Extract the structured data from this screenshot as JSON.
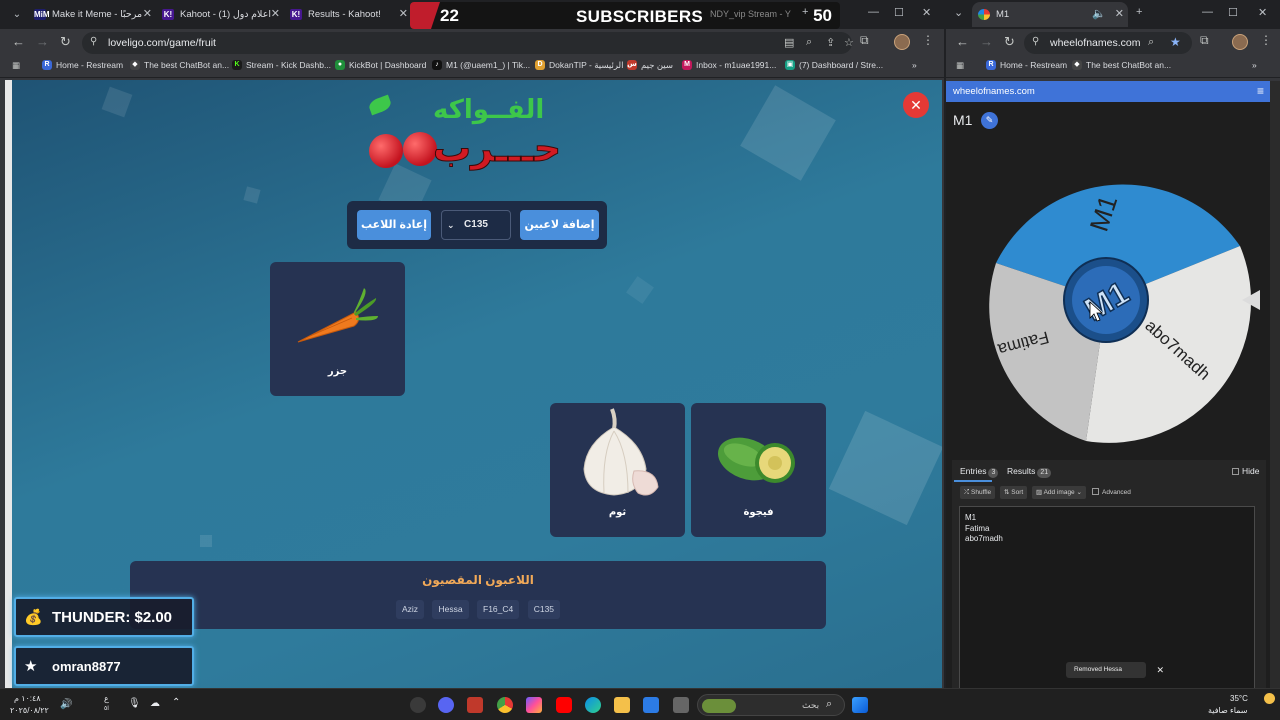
{
  "left_window": {
    "tabs": [
      {
        "label": "Make it Meme - مرحبًا",
        "favicon": "MiM"
      },
      {
        "label": "Kahoot - (1) اعلام دول",
        "favicon": "K!"
      },
      {
        "label": "Results - Kahoot!",
        "favicon": "K!"
      }
    ],
    "hidden_tab_fragment": "NDY_vip Stream - Y",
    "subscribers_banner": {
      "left_count": "22",
      "label": "SUBSCRIBERS",
      "right_count": "50"
    },
    "url": "loveligo.com/game/fruit",
    "bookmarks": [
      {
        "label": "Home - Restream",
        "icon": "R"
      },
      {
        "label": "The best ChatBot an...",
        "icon": "◆"
      },
      {
        "label": "Stream - Kick Dashb...",
        "icon": "K"
      },
      {
        "label": "KickBot | Dashboard",
        "icon": "●"
      },
      {
        "label": "M1 (@uaem1_) | Tik...",
        "icon": "♪"
      },
      {
        "label": "DokanTIP - الرئيسية",
        "icon": "D"
      },
      {
        "label": "سين جيم",
        "icon": "س"
      },
      {
        "label": "Inbox - m1uae1991...",
        "icon": "M"
      },
      {
        "label": "(7) Dashboard / Stre...",
        "icon": "▣"
      }
    ]
  },
  "game": {
    "logo_top": "الفــواكه",
    "logo_bottom": "حـــرب",
    "reset_button": "إعادة اللاعب",
    "player_select_value": "C135",
    "add_players_button": "إضافة لاعبين",
    "cards": [
      {
        "name": "جزر",
        "fruit": "carrot"
      },
      {
        "name": "ثوم",
        "fruit": "garlic"
      },
      {
        "name": "فيجوة",
        "fruit": "feijoa"
      }
    ],
    "eliminated_title": "اللاعبون المقصيون",
    "eliminated_players": [
      "Aziz",
      "Hessa",
      "F16_C4",
      "C135"
    ]
  },
  "alerts": [
    {
      "icon": "money-bag-icon",
      "text": "THUNDER: $2.00"
    },
    {
      "icon": "star-icon",
      "text": "omran8877"
    }
  ],
  "right_window": {
    "tab_label": "M1",
    "url": "wheelofnames.com",
    "bookmarks": [
      {
        "label": "Home - Restream",
        "icon": "R"
      },
      {
        "label": "The best ChatBot an...",
        "icon": "◆"
      }
    ],
    "site_header": "wheelofnames.com",
    "wheel_title": "M1",
    "wheel_center_text": "M1",
    "wheel_segments": [
      {
        "label": "M1",
        "color": "#2f8bd0"
      },
      {
        "label": "abo7madh",
        "color": "#e6e6e6"
      },
      {
        "label": "Fatima",
        "color": "#c9c9c9"
      }
    ],
    "panel_tabs": [
      {
        "label": "Entries",
        "count": "3"
      },
      {
        "label": "Results",
        "count": "21"
      }
    ],
    "hide_label": "Hide",
    "tools": [
      "Shuffle",
      "Sort",
      "Add image"
    ],
    "advanced_label": "Advanced",
    "entries": [
      "M1",
      "Fatima",
      "abo7madh"
    ],
    "toast": "Removed Hessa"
  },
  "taskbar": {
    "time": "١٠:٤٨ م",
    "date": "٢٠٢٥/٠٨/٢٢",
    "input_lang": "ع",
    "input_lang_sub": "ا٥",
    "search_placeholder": "بحث",
    "weather_temp": "35°C",
    "weather_desc": "سماء صافية"
  }
}
